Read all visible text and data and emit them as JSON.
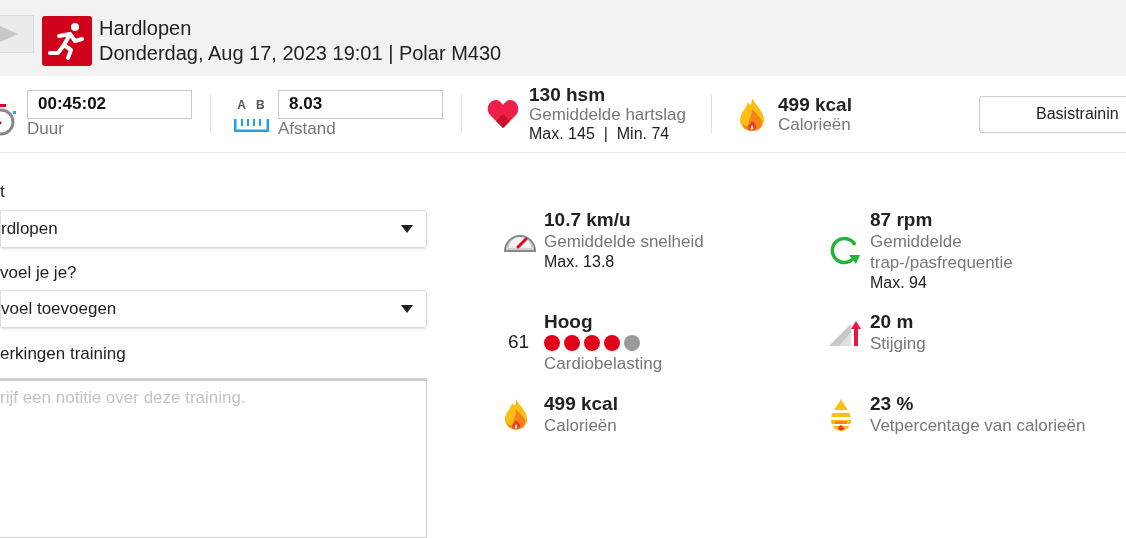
{
  "header": {
    "title": "Hardlopen",
    "subtitle": "Donderdag, Aug 17, 2023 19:01 | Polar M430"
  },
  "summary": {
    "duration": {
      "value": "00:45:02",
      "label": "Duur"
    },
    "distance": {
      "letters": [
        "A",
        "B"
      ],
      "value": "8.03",
      "label": "Afstand"
    },
    "heart_rate": {
      "value": "130 hsm",
      "label": "Gemiddelde hartslag",
      "detail": "Max. 145  |  Min. 74"
    },
    "calories": {
      "value": "499 kcal",
      "label": "Calorieën"
    },
    "button": "Basistrainin"
  },
  "form": {
    "sport_label": "t",
    "sport_value": "rdlopen",
    "feeling_label": "voel je je?",
    "feeling_value": "voel toevoegen",
    "notes_label": "erkingen training",
    "notes_placeholder": "rijf een notitie over deze training."
  },
  "metrics": [
    {
      "kind": "speed",
      "value": "10.7 km/u",
      "label": "Gemiddelde snelheid",
      "detail": "Max. 13.8"
    },
    {
      "kind": "cadence",
      "value": "87 rpm",
      "label": "Gemiddelde trap-/pasfrequentie",
      "detail": "Max. 94"
    },
    {
      "kind": "cardio",
      "score": "61",
      "value": "Hoog",
      "stars": 4,
      "label": "Cardiobelasting"
    },
    {
      "kind": "ascent",
      "value": "20 m",
      "label": "Stijging"
    },
    {
      "kind": "calories",
      "value": "499 kcal",
      "label": "Calorieën"
    },
    {
      "kind": "fat",
      "value": "23 %",
      "label": "Vetpercentage van calorieën"
    }
  ]
}
